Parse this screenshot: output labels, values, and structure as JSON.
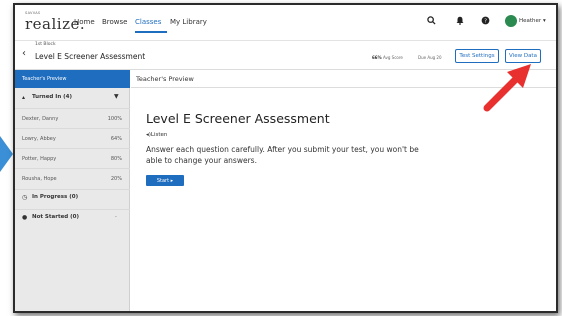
{
  "nav": {
    "logo_sub": "SAVVAS",
    "logo": "realize.",
    "links": [
      "Home",
      "Browse",
      "Classes",
      "My Library"
    ],
    "active": "Classes",
    "icons": [
      "search-icon",
      "bell-icon",
      "help-icon"
    ],
    "user": "Heather"
  },
  "assessment": {
    "class_name": "1st Block",
    "title": "Level E Screener Assessment",
    "avg_score_value": "66%",
    "avg_score_label": "Avg Score",
    "due": "Due Aug 20",
    "test_settings": "Test Settings",
    "view_data": "View Data"
  },
  "sidebar": {
    "preview_label": "Teacher's Preview",
    "turned_in": {
      "label": "Turned In (4)",
      "students": [
        {
          "name": "Dexter, Danny",
          "score": "100%"
        },
        {
          "name": "Lowry, Abbey",
          "score": "64%"
        },
        {
          "name": "Potter, Happy",
          "score": "80%"
        },
        {
          "name": "Rousha, Hope",
          "score": "20%"
        }
      ]
    },
    "in_progress": {
      "label": "In Progress (0)"
    },
    "not_started": {
      "label": "Not Started (0)",
      "score": "-"
    }
  },
  "main": {
    "header": "Teacher's Preview",
    "title": "Level E Screener Assessment",
    "listen": "Listen",
    "instructions": "Answer each question carefully. After you submit your test, you won't be able to change your answers.",
    "start": "Start"
  },
  "colors": {
    "accent": "#1f6dbf",
    "annotation_arrow": "#e8302f",
    "outer_arrow": "#3a8fd6"
  }
}
